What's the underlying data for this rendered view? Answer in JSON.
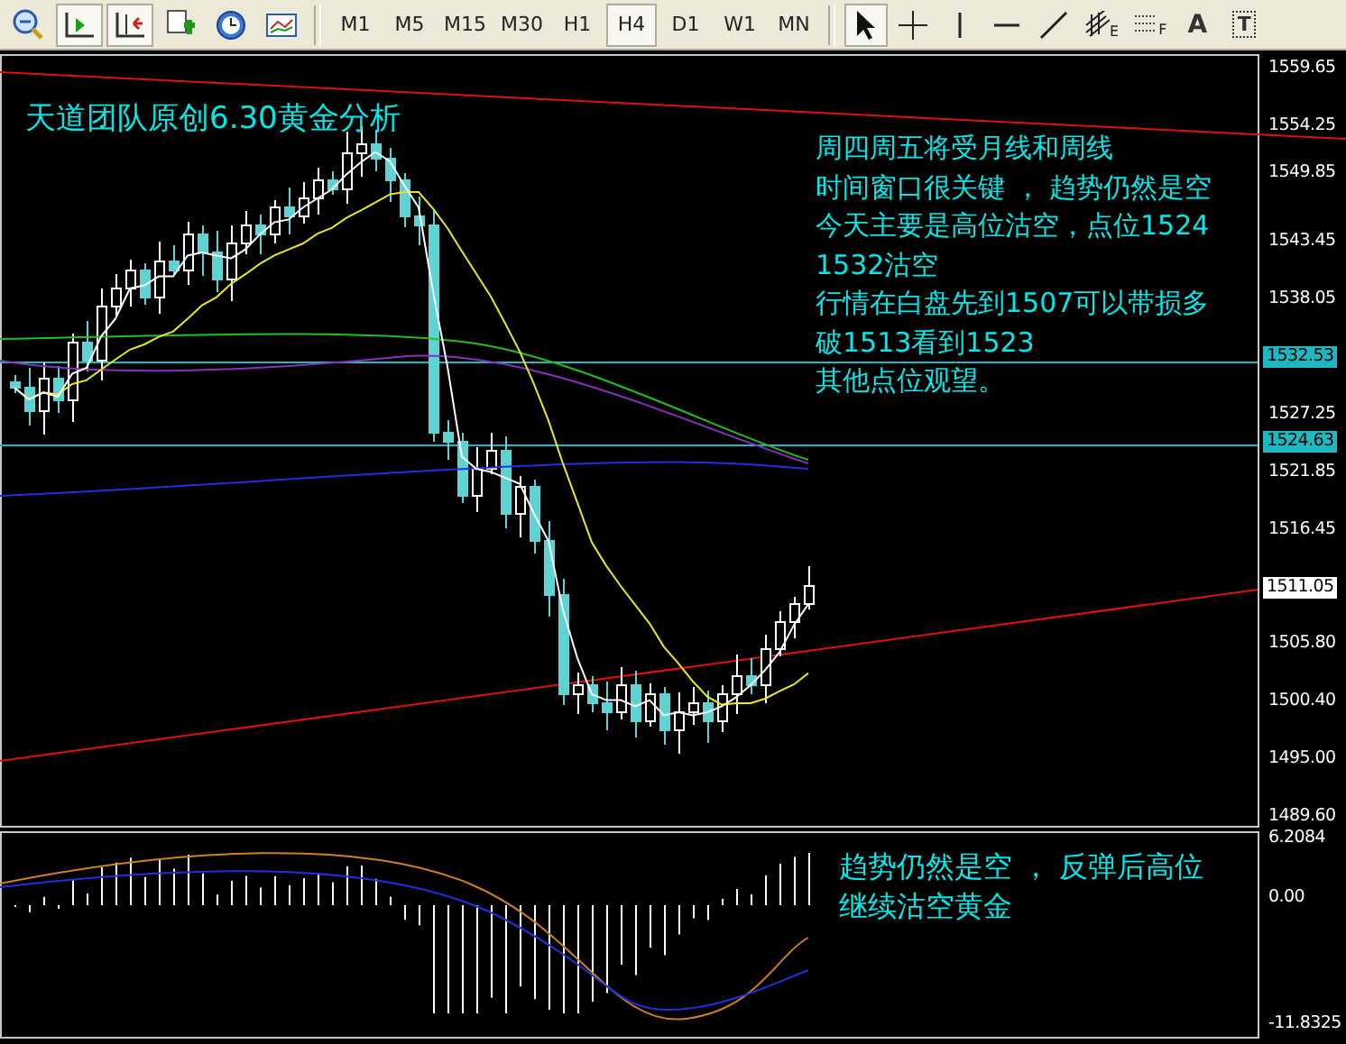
{
  "toolbar": {
    "chart_buttons": [
      {
        "kind": "zoom-out",
        "selected": false
      },
      {
        "kind": "chart-shift",
        "selected": true
      },
      {
        "kind": "auto-scroll",
        "selected": true
      },
      {
        "kind": "new-chart",
        "selected": false
      },
      {
        "kind": "clock",
        "selected": false
      },
      {
        "kind": "indicators",
        "selected": false
      }
    ],
    "timeframes": [
      {
        "label": "M1",
        "selected": false
      },
      {
        "label": "M5",
        "selected": false
      },
      {
        "label": "M15",
        "selected": false
      },
      {
        "label": "M30",
        "selected": false
      },
      {
        "label": "H1",
        "selected": false
      },
      {
        "label": "H4",
        "selected": true
      },
      {
        "label": "D1",
        "selected": false
      },
      {
        "label": "W1",
        "selected": false
      },
      {
        "label": "MN",
        "selected": false
      }
    ],
    "tools": [
      {
        "kind": "cursor",
        "selected": true
      },
      {
        "kind": "crosshair",
        "selected": false
      },
      {
        "kind": "vline",
        "selected": false
      },
      {
        "kind": "hline",
        "selected": false
      },
      {
        "kind": "trendline",
        "selected": false
      },
      {
        "kind": "channel",
        "label": "E",
        "selected": false
      },
      {
        "kind": "grid",
        "label": "F",
        "selected": false
      },
      {
        "kind": "text",
        "label": "A",
        "selected": false
      },
      {
        "kind": "textlabel",
        "label": "T",
        "selected": false
      }
    ]
  },
  "chart": {
    "title": "天道团队原创6.30黄金分析",
    "notes": [
      "周四周五将受月线和周线",
      "时间窗口很关键 ， 趋势仍然是空",
      "今天主要是高位沽空，点位1524",
      "1532沽空",
      "行情在白盘先到1507可以带损多",
      "破1513看到1523",
      "其他点位观望。"
    ],
    "price_axis": [
      {
        "text": "1559.65",
        "kind": "tick"
      },
      {
        "text": "1554.25",
        "kind": "tick"
      },
      {
        "text": "1549.85",
        "kind": "tick"
      },
      {
        "text": "1543.45",
        "kind": "tick"
      },
      {
        "text": "1538.05",
        "kind": "tick"
      },
      {
        "text": "1532.53",
        "kind": "line"
      },
      {
        "text": "1527.25",
        "kind": "tick"
      },
      {
        "text": "1524.63",
        "kind": "line"
      },
      {
        "text": "1521.85",
        "kind": "tick"
      },
      {
        "text": "1516.45",
        "kind": "tick"
      },
      {
        "text": "1511.05",
        "kind": "current"
      },
      {
        "text": "1505.80",
        "kind": "tick"
      },
      {
        "text": "1500.40",
        "kind": "tick"
      },
      {
        "text": "1495.00",
        "kind": "tick"
      },
      {
        "text": "1489.60",
        "kind": "tick"
      }
    ]
  },
  "indicator": {
    "notes": [
      "趋势仍然是空 ， 反弹后高位",
      "继续沽空黄金"
    ],
    "axis": [
      "6.2084",
      "0.00",
      "-11.8325"
    ]
  }
}
